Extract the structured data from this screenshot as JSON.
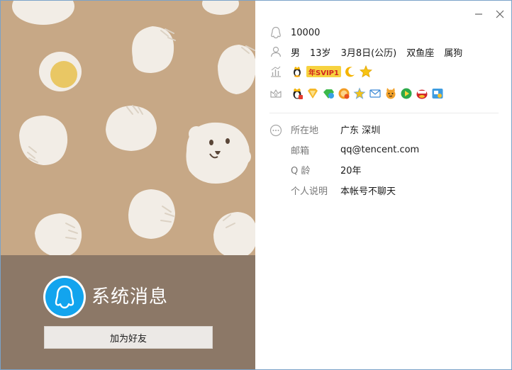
{
  "profile": {
    "display_name": "系统消息",
    "add_friend_label": "加为好友"
  },
  "info": {
    "qq_number": "10000",
    "gender": "男",
    "age": "13岁",
    "birthday": "3月8日(公历)",
    "zodiac": "双鱼座",
    "chinese_zodiac": "属狗",
    "vip_badge": "年SVIP1",
    "vip_prefix_icon": "qq-penguin-crown-icon"
  },
  "details": {
    "location_label": "所在地",
    "location_value": "广东 深圳",
    "email_label": "邮箱",
    "email_value": "qq@tencent.com",
    "qage_label": "Q 龄",
    "qage_value": "20年",
    "bio_label": "个人说明",
    "bio_value": "本帐号不聊天"
  },
  "colors": {
    "art_background": "#c7a886",
    "bottom_panel": "#8c7867",
    "avatar_blue": "#12a4ee",
    "vip_gold": "#f7d23f"
  }
}
